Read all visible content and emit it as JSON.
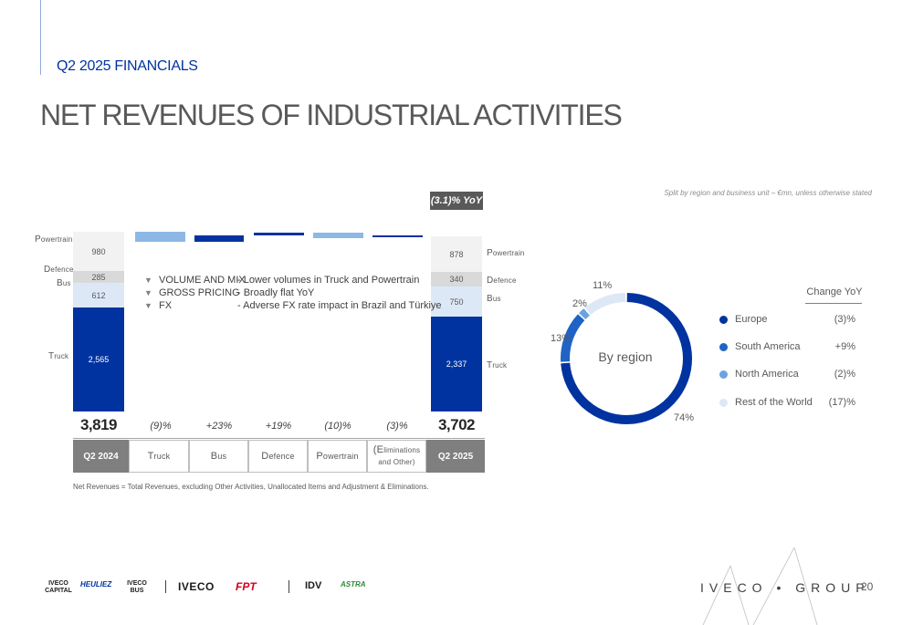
{
  "header": {
    "section": "Q2 2025 FINANCIALS",
    "title": "NET REVENUES OF INDUSTRIAL ACTIVITIES",
    "subtitle": "Split by region and business unit – €mn, unless otherwise stated"
  },
  "yoy_badge": "(3.1)% YoY",
  "bridge": {
    "start_stack": {
      "powertrain_label": "Powertrain",
      "powertrain_value": "980",
      "defence_label": "Defence",
      "defence_value": "285",
      "bus_label": "Bus",
      "bus_value": "612",
      "truck_label": "Truck",
      "truck_value": "2,565"
    },
    "end_stack": {
      "powertrain_label": "Powertrain",
      "powertrain_value": "878",
      "defence_label": "Defence",
      "defence_value": "340",
      "bus_label": "Bus",
      "bus_value": "750",
      "truck_label": "Truck",
      "truck_value": "2,337"
    },
    "start_total": "3,819",
    "end_total": "3,702",
    "changes": [
      "(9)%",
      "+23%",
      "+19%",
      "(10)%",
      "(3)%"
    ],
    "categories": [
      "Q2 2024",
      "Truck",
      "Bus",
      "Defence",
      "Powertrain",
      "(Eliminations and Other)",
      "Q2 2025"
    ],
    "bullets": [
      {
        "key": "VOLUME AND MIX",
        "text": "- Lower volumes in Truck and Powertrain"
      },
      {
        "key": "GROSS PRICING",
        "text": "- Broadly flat YoY"
      },
      {
        "key": "FX",
        "text": "- Adverse FX rate impact in Brazil and Türkiye"
      }
    ],
    "footnote": "Net Revenues = Total Revenues, excluding Other Activities, Unallocated Items and Adjustment & Eliminations."
  },
  "chart_data": [
    {
      "type": "bar",
      "categories": [
        "Q2 2024",
        "Truck",
        "Bus",
        "Defence",
        "Powertrain",
        "(Eliminations and Other)",
        "Q2 2025"
      ],
      "series": [
        {
          "name": "Truck",
          "values": [
            2565,
            null,
            null,
            null,
            null,
            null,
            2337
          ]
        },
        {
          "name": "Bus",
          "values": [
            612,
            null,
            null,
            null,
            null,
            null,
            750
          ]
        },
        {
          "name": "Defence",
          "values": [
            285,
            null,
            null,
            null,
            null,
            null,
            340
          ]
        },
        {
          "name": "Powertrain",
          "values": [
            980,
            null,
            null,
            null,
            null,
            null,
            878
          ]
        }
      ],
      "bridge_changes_pct": [
        -9,
        23,
        19,
        -10,
        -3
      ],
      "totals": [
        3819,
        3702
      ]
    },
    {
      "type": "pie",
      "center_label": "By region",
      "slices": [
        {
          "label": "Europe",
          "value": 74,
          "color": "#0033a0",
          "change": "(3)%"
        },
        {
          "label": "South America",
          "value": 13,
          "color": "#1f63c6",
          "change": "+9%"
        },
        {
          "label": "North America",
          "value": 2,
          "color": "#6aa4e0",
          "change": "(2)%"
        },
        {
          "label": "Rest of the World",
          "value": 11,
          "color": "#dde8f6",
          "change": "(17)%"
        }
      ],
      "pct_labels": [
        "74%",
        "13%",
        "2%",
        "11%"
      ],
      "legend_header": "Change YoY"
    }
  ],
  "footer": {
    "brands": [
      "IVECO CAPITAL",
      "HEULIEZ",
      "IVECO BUS",
      "IVECO",
      "FPT",
      "IDV",
      "ASTRA"
    ],
    "group_logo": "IVECO • GROUP",
    "page": "20"
  },
  "colors": {
    "brand_blue": "#0033a0",
    "light_blue": "#dde8f6",
    "mid_blue": "#6aa4e0",
    "grey_dark": "#7f7f7f"
  }
}
